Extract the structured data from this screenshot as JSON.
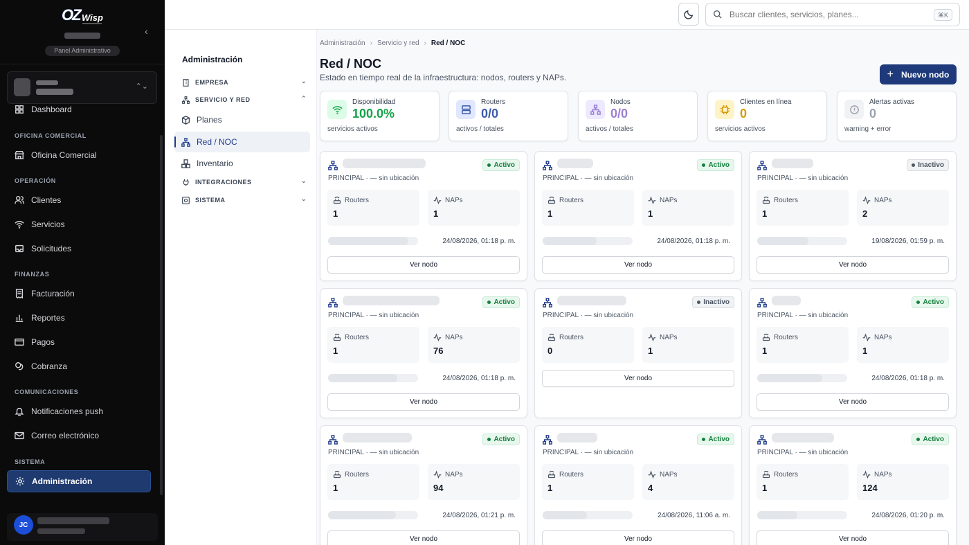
{
  "sidebar": {
    "logo_text_1": "OZ",
    "logo_text_2": "Wisp",
    "panel_label": "Panel Administrativo",
    "sections": {
      "oficina": "OFICINA COMERCIAL",
      "operacion": "OPERACIÓN",
      "finanzas": "FINANZAS",
      "comunicaciones": "COMUNICACIONES",
      "sistema": "SISTEMA"
    },
    "items": {
      "dashboard": "Dashboard",
      "oficina": "Oficina Comercial",
      "clientes": "Clientes",
      "servicios": "Servicios",
      "solicitudes": "Solicitudes",
      "facturacion": "Facturación",
      "reportes": "Reportes",
      "pagos": "Pagos",
      "cobranza": "Cobranza",
      "push": "Notificaciones push",
      "correo": "Correo electrónico",
      "admin": "Administración"
    },
    "user_initials": "JC"
  },
  "topbar": {
    "search_placeholder": "Buscar clientes, servicios, planes...",
    "shortcut": "⌘K"
  },
  "subnav": {
    "title": "Administración",
    "empresa": "EMPRESA",
    "servicio_red": "SERVICIO Y RED",
    "planes": "Planes",
    "red_noc": "Red / NOC",
    "inventario": "Inventario",
    "integraciones": "INTEGRACIONES",
    "sistema": "SISTEMA"
  },
  "breadcrumb": {
    "c1": "Administración",
    "c2": "Servicio y red",
    "c3": "Red / NOC"
  },
  "page": {
    "title": "Red / NOC",
    "subtitle": "Estado en tiempo real de la infraestructura: nodos, routers y NAPs.",
    "new_button": "Nuevo nodo"
  },
  "stats": [
    {
      "label": "Disponibilidad",
      "value": "100.0%",
      "foot": "servicios activos",
      "color": "#16a34a"
    },
    {
      "label": "Routers",
      "value": "0/0",
      "foot": "activos / totales",
      "color": "#3b5bab"
    },
    {
      "label": "Nodos",
      "value": "0/0",
      "foot": "activos / totales",
      "color": "#9b7fd1"
    },
    {
      "label": "Clientes en línea",
      "value": "0",
      "foot": "servicios activos",
      "color": "#d99a0b"
    },
    {
      "label": "Alertas activas",
      "value": "0",
      "foot": "warning + error",
      "color": "#9ca3af"
    }
  ],
  "card_labels": {
    "routers": "Routers",
    "naps": "NAPs",
    "view": "Ver nodo",
    "location": "PRINCIPAL · — sin ubicación"
  },
  "nodes": [
    {
      "status": "Activo",
      "routers": "1",
      "naps": "1",
      "updated": "24/08/2026, 01:18 p. m."
    },
    {
      "status": "Activo",
      "routers": "1",
      "naps": "1",
      "updated": "24/08/2026, 01:18 p. m."
    },
    {
      "status": "Inactivo",
      "routers": "1",
      "naps": "2",
      "updated": "19/08/2026, 01:59 p. m."
    },
    {
      "status": "Activo",
      "routers": "1",
      "naps": "76",
      "updated": "24/08/2026, 01:18 p. m."
    },
    {
      "status": "Inactivo",
      "routers": "0",
      "naps": "1",
      "updated": ""
    },
    {
      "status": "Activo",
      "routers": "1",
      "naps": "1",
      "updated": "24/08/2026, 01:18 p. m."
    },
    {
      "status": "Activo",
      "routers": "1",
      "naps": "94",
      "updated": "24/08/2026, 01:21 p. m."
    },
    {
      "status": "Activo",
      "routers": "1",
      "naps": "4",
      "updated": "24/08/2026, 11:06 a. m."
    },
    {
      "status": "Activo",
      "routers": "1",
      "naps": "124",
      "updated": "24/08/2026, 01:20 p. m."
    }
  ]
}
